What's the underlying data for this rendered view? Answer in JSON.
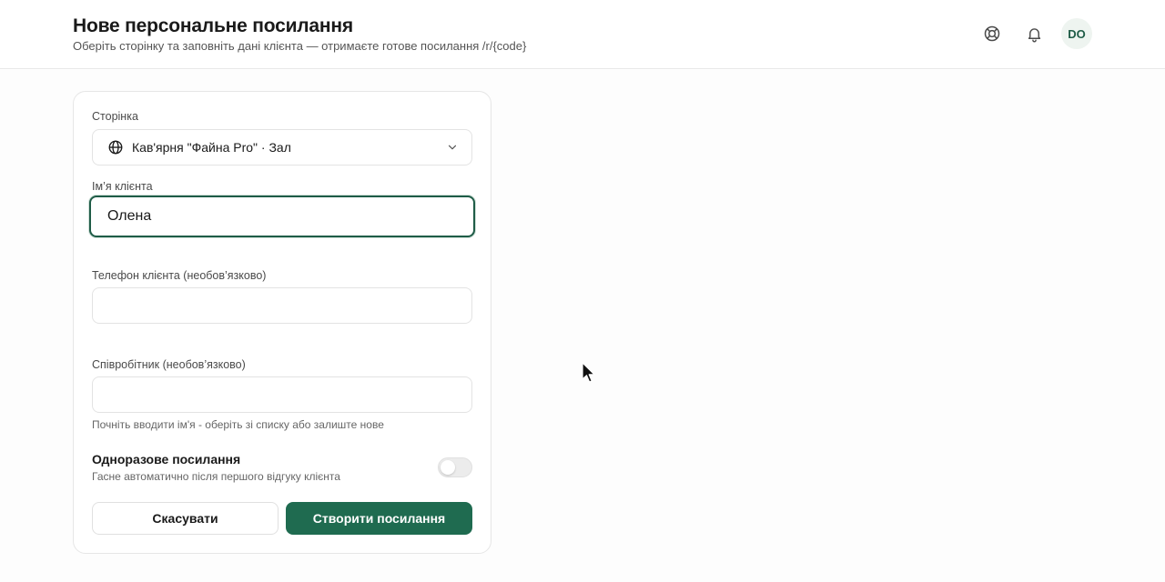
{
  "header": {
    "title": "Нове персональне посилання",
    "subtitle": "Оберіть сторінку та заповніть дані клієнта — отримаєте готове посилання /r/{code}",
    "actions": {
      "support_icon": "lifebuoy-icon",
      "notifications_icon": "bell-icon",
      "avatar_initials": "DO"
    }
  },
  "form": {
    "page_field": {
      "label": "Сторінка",
      "icon": "globe-icon",
      "selected_value": "Кав'ярня \"Файна Pro\" · Зал"
    },
    "client_name": {
      "label": "Ім’я клієнта",
      "value": "Олена"
    },
    "client_phone": {
      "label": "Телефон клієнта (необов’язково)",
      "value": ""
    },
    "employee": {
      "label": "Співробітник (необов’язково)",
      "value": "",
      "hint": "Почніть вводити ім'я - оберіть зі списку або залиште нове"
    },
    "one_time": {
      "title": "Одноразове посилання",
      "description": "Гасне автоматично після першого відгуку клієнта",
      "enabled": false
    },
    "buttons": {
      "cancel_label": "Скасувати",
      "create_label": "Створити посилання"
    }
  },
  "colors": {
    "accent": "#1f6b50",
    "focus_border": "#1f5c47",
    "avatar_bg": "#eef4f0"
  }
}
